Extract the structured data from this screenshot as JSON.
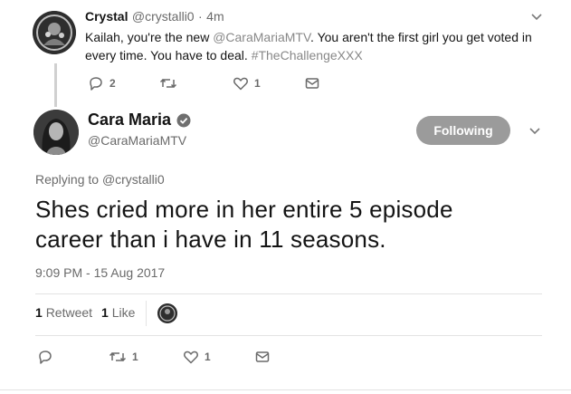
{
  "reply_tweet": {
    "name": "Crystal",
    "handle": "@crystalli0",
    "separator": "·",
    "time": "4m",
    "text_parts": {
      "p1": "Kailah, you're the new ",
      "mention": "@CaraMariaMTV",
      "p2": ". You aren't the first girl you get voted in every time. You have to deal. ",
      "hashtag": "#TheChallengeXXX"
    },
    "actions": {
      "reply_count": "2",
      "retweet_count": "",
      "like_count": "1"
    }
  },
  "main_tweet": {
    "name": "Cara Maria",
    "verified_icon": "verified-badge-icon",
    "handle": "@CaraMariaMTV",
    "follow_button": "Following",
    "replying_prefix": "Replying to ",
    "replying_to": "@crystalli0",
    "text": "Shes cried more in her entire 5 episode career than i have in 11 seasons.",
    "timestamp": "9:09 PM - 15 Aug 2017",
    "stats": {
      "retweets_count": "1",
      "retweets_label": "Retweet",
      "likes_count": "1",
      "likes_label": "Like"
    },
    "actions": {
      "reply_count": "",
      "retweet_count": "1",
      "like_count": "1"
    }
  },
  "colors": {
    "text": "#141414",
    "muted": "#6a6a6a",
    "button": "#9b9b9b",
    "divider": "#e3e3e3"
  }
}
